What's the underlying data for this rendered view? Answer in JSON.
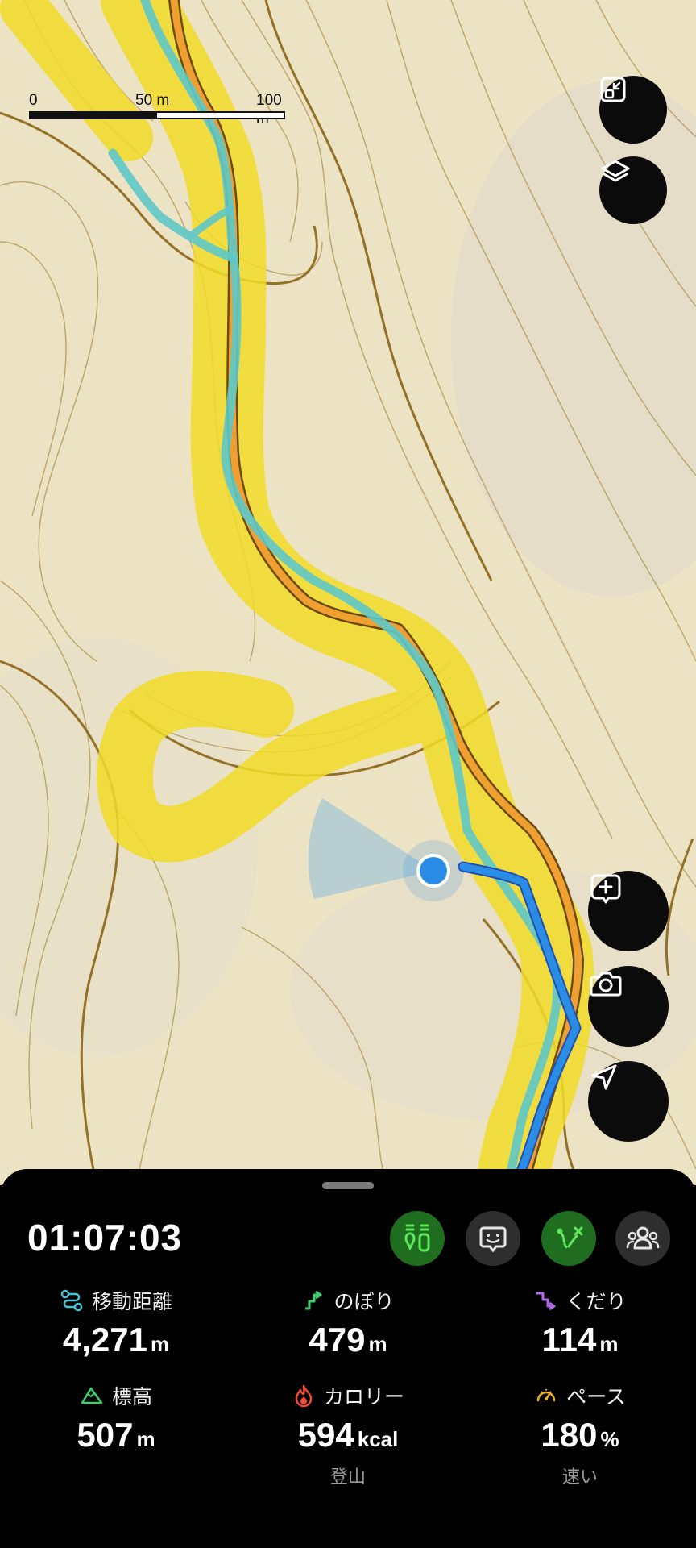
{
  "map": {
    "scale": {
      "label_0": "0",
      "label_mid": "50 m",
      "label_max": "100 m"
    },
    "colors": {
      "terrain": "#eee4c8",
      "contour": "#a07c2a",
      "heat": "#f2dc28",
      "planned_route": "#f0a030",
      "track": "#5ec8c8",
      "current_track": "#2b8ce6",
      "position": "#2b8ce6"
    },
    "controls": {
      "fit": {
        "icon": "fit-screen-icon"
      },
      "layers": {
        "icon": "layers-icon"
      },
      "add": {
        "icon": "plus-bubble-icon"
      },
      "camera": {
        "icon": "camera-icon"
      },
      "locate": {
        "icon": "navigation-arrow-icon"
      }
    }
  },
  "sheet": {
    "elapsed_time": "01:07:03",
    "modes": [
      {
        "icon": "checkpoint-icon",
        "active": true
      },
      {
        "icon": "friend-face-icon",
        "active": false
      },
      {
        "icon": "route-icon",
        "active": true
      },
      {
        "icon": "group-icon",
        "active": false
      }
    ],
    "stats": [
      {
        "key": "distance",
        "label": "移動距離",
        "value": "4,271",
        "unit": "m",
        "icon": "route-distance-icon",
        "icon_color": "#4fc3d6",
        "sub": ""
      },
      {
        "key": "ascent",
        "label": "のぼり",
        "value": "479",
        "unit": "m",
        "icon": "ascent-arrow-icon",
        "icon_color": "#3fcf6a",
        "sub": ""
      },
      {
        "key": "descent",
        "label": "くだり",
        "value": "114",
        "unit": "m",
        "icon": "descent-arrow-icon",
        "icon_color": "#b06be8",
        "sub": ""
      },
      {
        "key": "elevation",
        "label": "標高",
        "value": "507",
        "unit": "m",
        "icon": "mountain-icon",
        "icon_color": "#3fcf6a",
        "sub": ""
      },
      {
        "key": "calories",
        "label": "カロリー",
        "value": "594",
        "unit": "kcal",
        "icon": "flame-icon",
        "icon_color": "#f04a3a",
        "sub": "登山"
      },
      {
        "key": "pace",
        "label": "ペース",
        "value": "180",
        "unit": "%",
        "icon": "speedometer-icon",
        "icon_color": "#f0b030",
        "sub": "速い"
      }
    ]
  }
}
